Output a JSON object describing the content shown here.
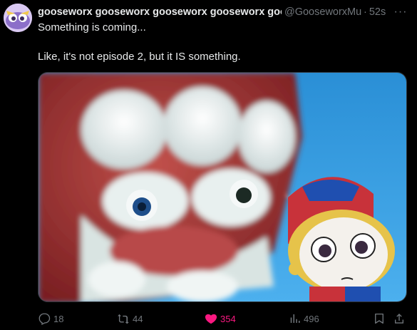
{
  "tweet": {
    "display_name": "gooseworx gooseworx gooseworx gooseworx gooseworx",
    "handle": "@GooseworxMusic",
    "separator": "·",
    "time": "52s",
    "more_label": "···",
    "text_line_1": "Something is coming...",
    "text_line_2": "Like, it's not episode 2, but it IS something."
  },
  "actions": {
    "replies": "18",
    "retweets": "44",
    "likes": "354",
    "views": "496"
  },
  "icons": {
    "avatar": "gooseworx-avatar-icon",
    "more": "more-options-icon",
    "reply": "reply-icon",
    "retweet": "retweet-icon",
    "like": "heart-icon",
    "views": "analytics-icon",
    "bookmark": "bookmark-icon",
    "share": "share-icon"
  },
  "colors": {
    "background": "#000000",
    "text": "#e7e9ea",
    "muted": "#71767b",
    "like": "#f91880"
  }
}
